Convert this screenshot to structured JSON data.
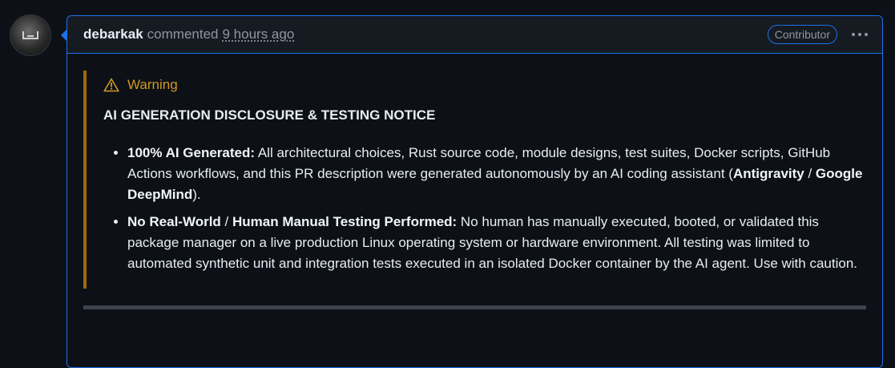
{
  "comment": {
    "author": "debarkak",
    "verb": "commented",
    "time": "9 hours ago",
    "badge": "Contributor"
  },
  "alert": {
    "label": "Warning",
    "heading": "AI GENERATION DISCLOSURE & TESTING NOTICE",
    "items": [
      {
        "parts": [
          {
            "text": "100% AI Generated:",
            "bold": true
          },
          {
            "text": " All architectural choices, Rust source code, module designs, test suites, Docker scripts, GitHub Actions workflows, and this PR description were generated autonomously by an AI coding assistant (",
            "bold": false
          },
          {
            "text": "Antigravity",
            "bold": true
          },
          {
            "text": " / ",
            "bold": false
          },
          {
            "text": "Google DeepMind",
            "bold": true
          },
          {
            "text": ").",
            "bold": false
          }
        ]
      },
      {
        "parts": [
          {
            "text": "No Real-World",
            "bold": true
          },
          {
            "text": " / ",
            "bold": false
          },
          {
            "text": "Human Manual Testing Performed:",
            "bold": true
          },
          {
            "text": " No human has manually executed, booted, or validated this package manager on a live production Linux operating system or hardware environment. All testing was limited to automated synthetic unit and integration tests executed in an isolated Docker container by the AI agent. Use with caution.",
            "bold": false
          }
        ]
      }
    ]
  },
  "icons": {
    "avatar": "avatar-image",
    "warning": "alert-triangle-icon",
    "menu": "kebab-horizontal-icon"
  },
  "colors": {
    "background": "#0d1117",
    "border_accent": "#1f6feb",
    "warning": "#d29922",
    "warning_bar": "#9e6a03"
  }
}
